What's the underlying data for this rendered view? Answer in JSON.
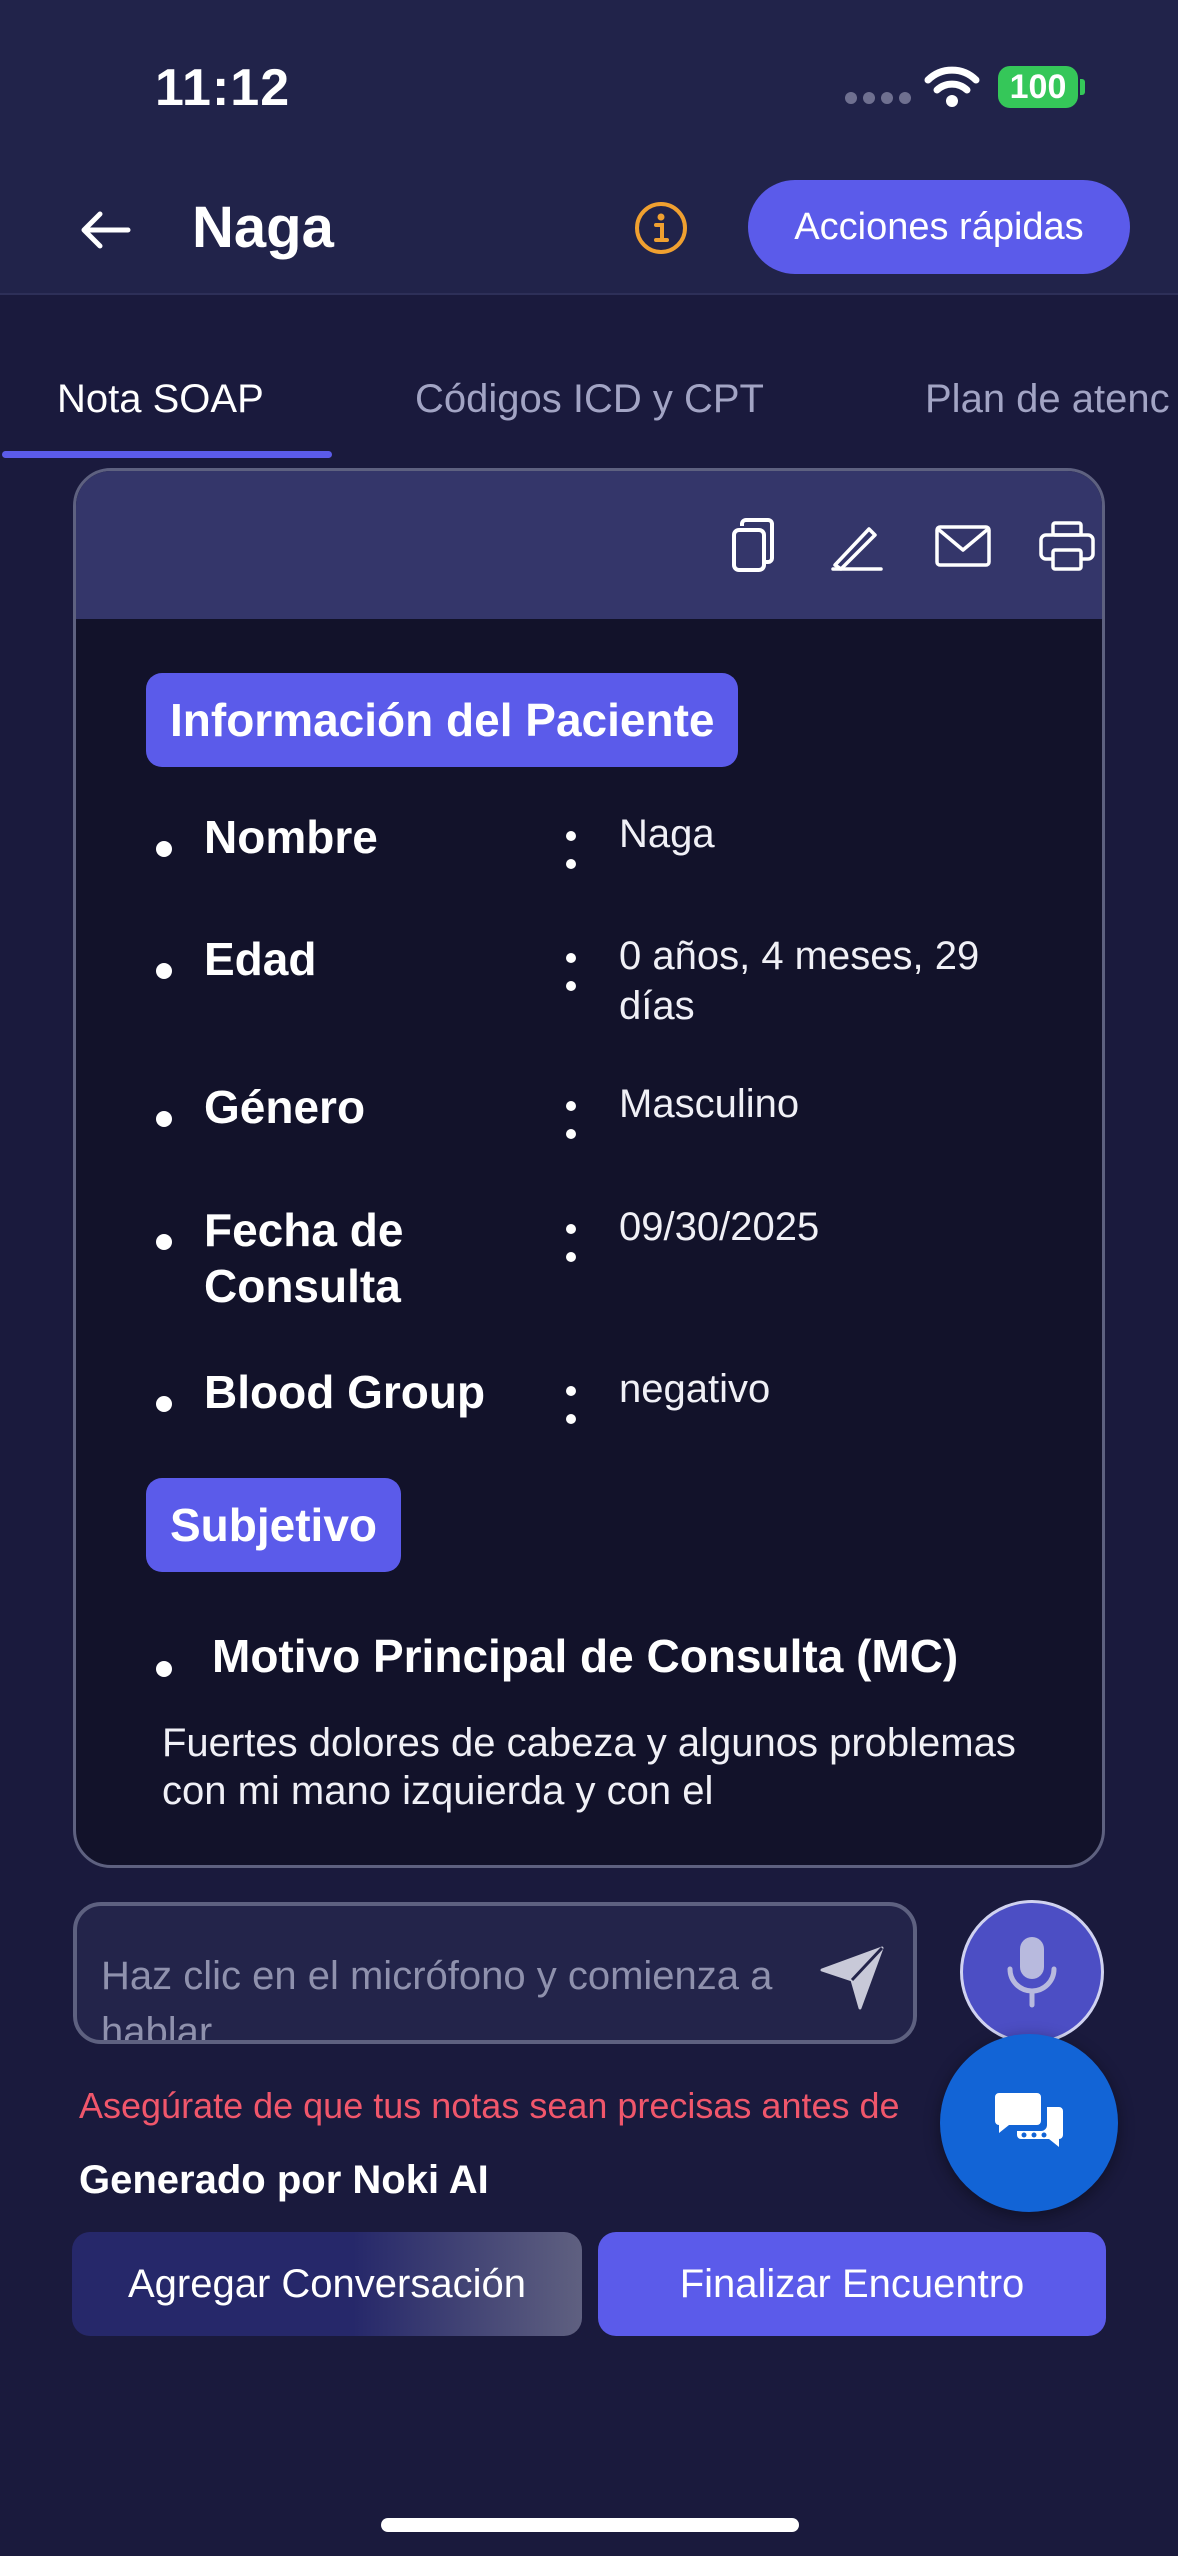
{
  "status_bar": {
    "time": "11:12",
    "battery": "100"
  },
  "header": {
    "title": "Naga",
    "quick_actions_label": "Acciones rápidas"
  },
  "tabs": [
    {
      "label": "Nota SOAP"
    },
    {
      "label": "Códigos ICD y CPT"
    },
    {
      "label": "Plan de atenc"
    }
  ],
  "card": {
    "toolbar_icons": [
      "copy-icon",
      "edit-icon",
      "mail-icon",
      "print-icon"
    ],
    "patient_section_title": "Información del Paciente",
    "patient_rows": [
      {
        "label": "Nombre",
        "value": "Naga"
      },
      {
        "label": "Edad",
        "value": "0 años, 4 meses, 29 días"
      },
      {
        "label": "Género",
        "value": "Masculino"
      },
      {
        "label": "Fecha de Consulta",
        "value": "09/30/2025"
      },
      {
        "label": "Blood Group",
        "value": "negativo"
      }
    ],
    "subjective_title": "Subjetivo",
    "chief_complaint_title": "Motivo Principal de Consulta (MC)",
    "chief_complaint_text": "Fuertes dolores de cabeza y algunos problemas con mi mano izquierda y con el"
  },
  "input": {
    "placeholder": "Haz clic en el micrófono y comienza a hablar..."
  },
  "warning": "Asegúrate de que tus notas sean precisas antes de",
  "generated_by": "Generado por Noki AI",
  "buttons": {
    "add_conversation": "Agregar Conversación",
    "finish_encounter": "Finalizar Encuentro"
  },
  "colors": {
    "accent": "#5b5bea",
    "background": "#1a1a3d",
    "card": "#12122a",
    "warning": "#f0566b",
    "fab": "#1264d6"
  }
}
